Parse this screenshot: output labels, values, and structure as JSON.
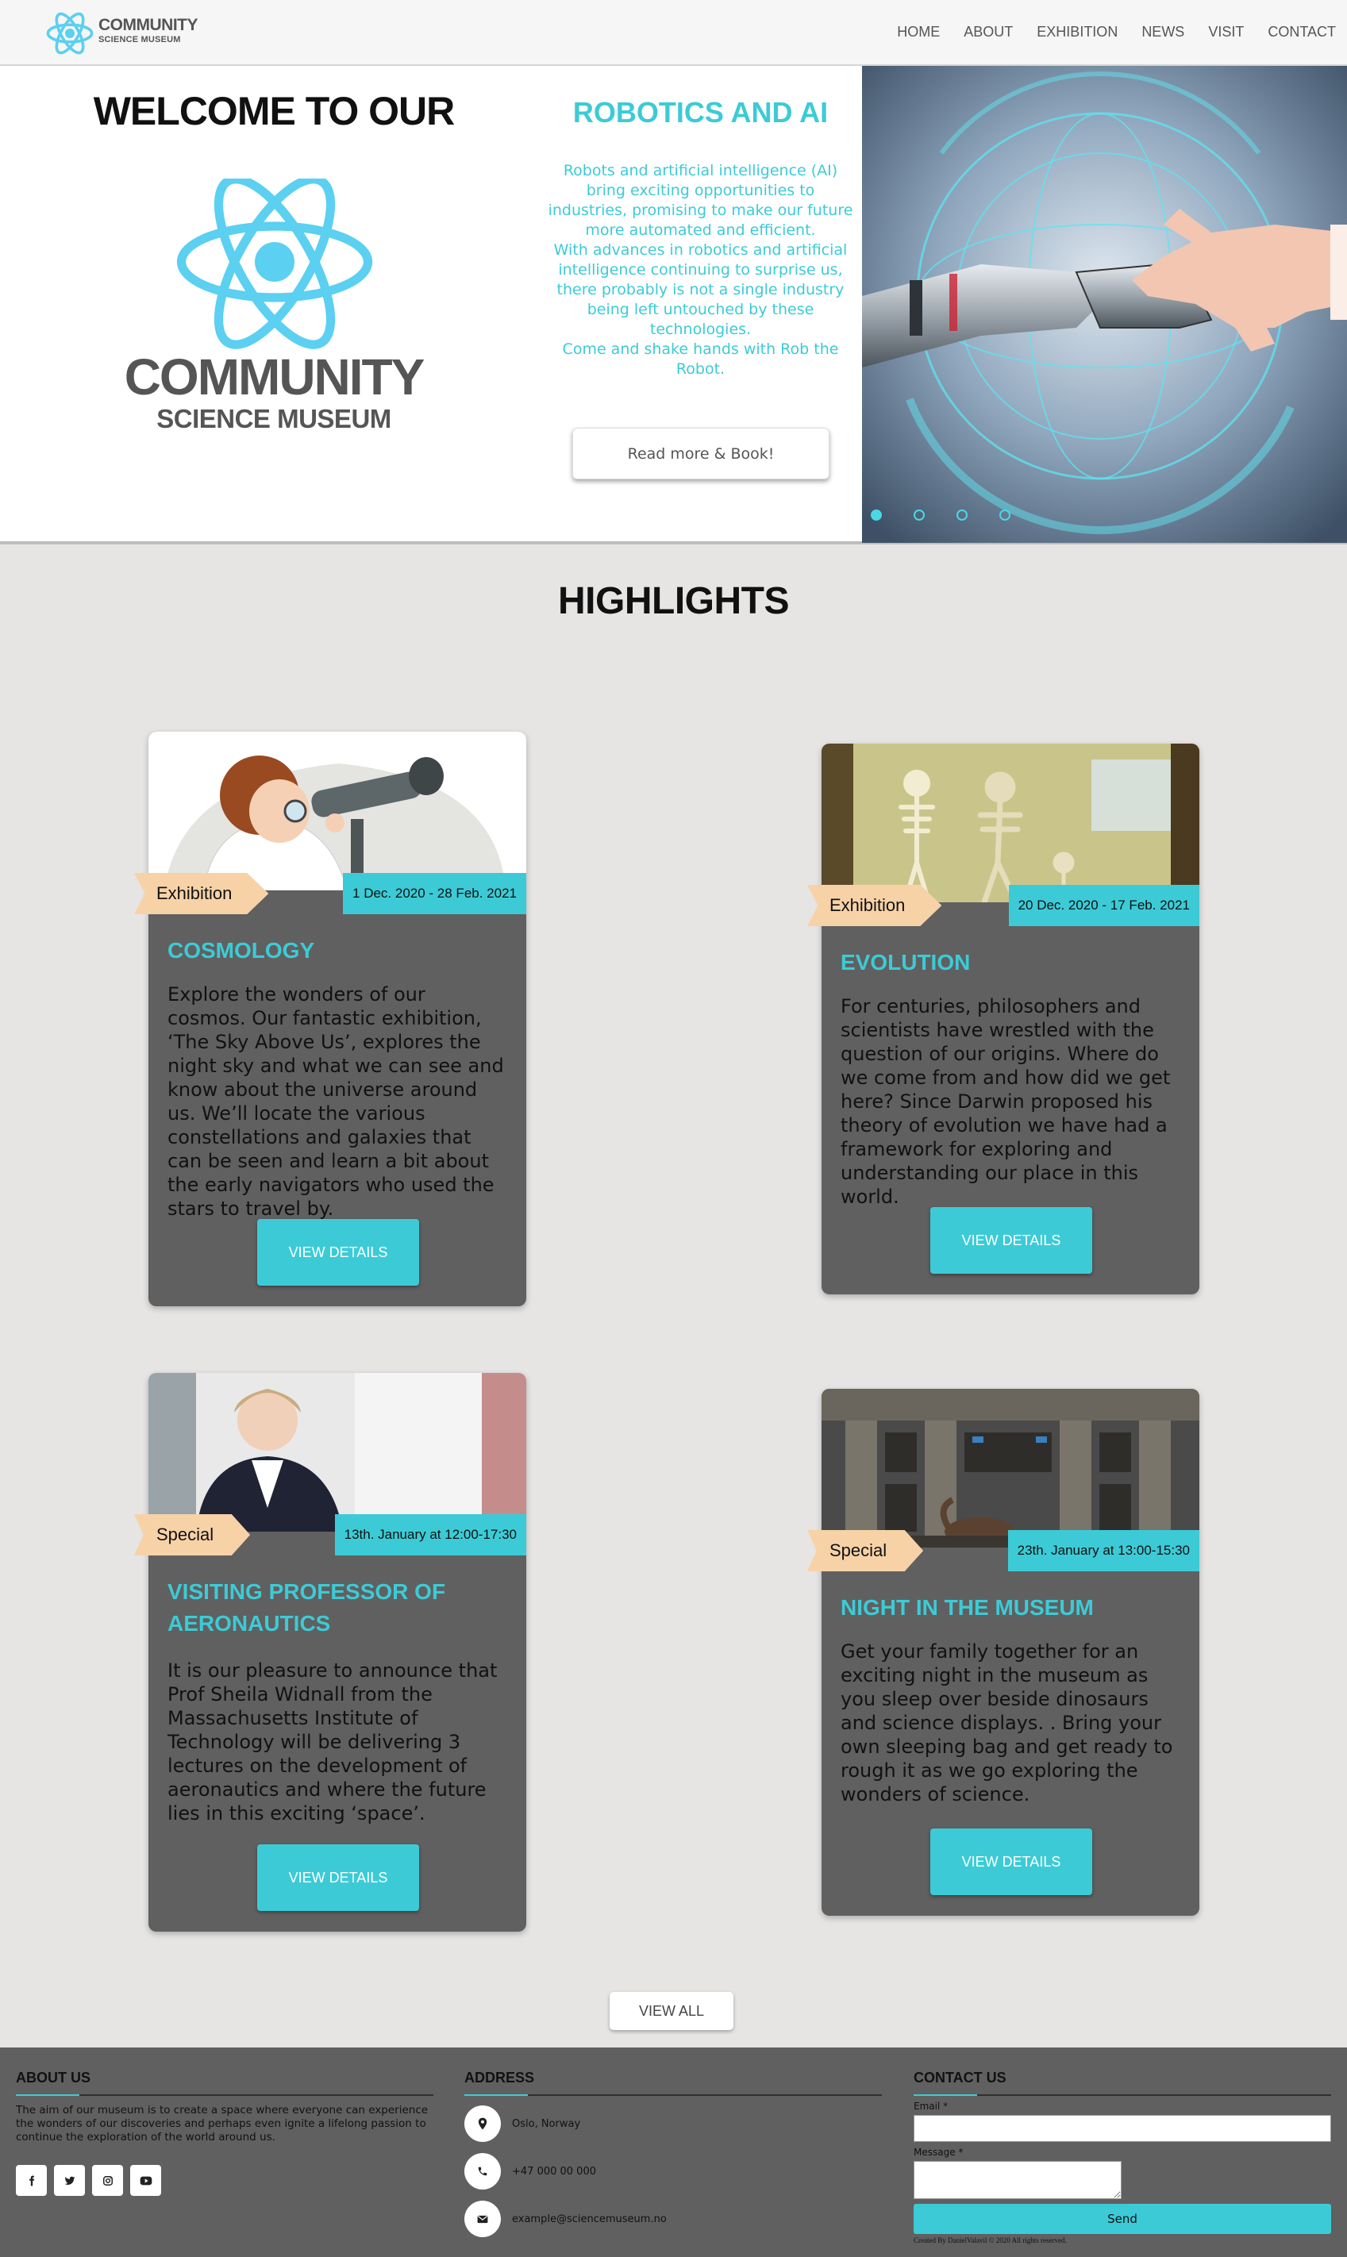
{
  "colors": {
    "accent": "#3ccbd6",
    "card": "#606060",
    "tag": "#f7d2a7",
    "background": "#e6e5e4"
  },
  "brand": {
    "line1": "COMMUNITY",
    "line2": "SCIENCE MUSEUM"
  },
  "nav": {
    "items": [
      "HOME",
      "ABOUT",
      "EXHIBITION",
      "NEWS",
      "VISIT",
      "CONTACT"
    ]
  },
  "hero": {
    "title": "WELCOME TO OUR",
    "slide_title": "ROBOTICS AND AI",
    "slide_text": "Robots and artificial intelligence (AI) bring exciting opportunities to industries, promising to make our future more automated and efficient.\nWith advances in robotics and artificial intelligence continuing to surprise us, there probably is not a single industry being left untouched by these technologies.\nCome and shake hands with Rob the Robot.",
    "button": "Read more & Book!",
    "slides_count": 4,
    "active_slide": 1
  },
  "highlights": {
    "title": "HIGHLIGHTS",
    "cards": [
      {
        "tag": "Exhibition",
        "date": "1 Dec. 2020 - 28 Feb. 2021",
        "title": "COSMOLOGY",
        "body": "Explore the wonders of our cosmos. Our fantastic exhibition, ‘The Sky Above Us’, explores the night sky and what we can see and know about the universe around us. We’ll locate the various constellations and galaxies that can be seen and learn a bit about the early navigators who used the stars to travel by.",
        "button": "VIEW DETAILS"
      },
      {
        "tag": "Exhibition",
        "date": "20 Dec. 2020 - 17 Feb. 2021",
        "title": "EVOLUTION",
        "body": "For centuries, philosophers and scientists have wrestled with the question of our origins. Where do we come from and how did we get here? Since Darwin proposed his theory of evolution we have had a framework for exploring and understanding our place in this world.",
        "button": "VIEW DETAILS"
      },
      {
        "tag": "Special",
        "date": "13th. January at 12:00-17:30",
        "title": "VISITING PROFESSOR OF AERONAUTICS",
        "body": "It is our pleasure to announce that Prof Sheila Widnall from the Massachusetts Institute of Technology will be delivering 3 lectures on the development of aeronautics and where the future lies in this exciting ‘space’.",
        "button": "VIEW DETAILS"
      },
      {
        "tag": "Special",
        "date": "23th. January at 13:00-15:30",
        "title": "NIGHT IN THE MUSEUM",
        "body": "Get your family together for an exciting night in the museum as you sleep over beside dinosaurs and science displays. . Bring your own sleeping bag and get ready to rough it as we go exploring the wonders of science.",
        "button": "VIEW DETAILS"
      }
    ],
    "view_all": "VIEW ALL"
  },
  "footer": {
    "about": {
      "heading": "ABOUT US",
      "text": "The aim of our museum is to create a space where everyone can experience the wonders of our discoveries and perhaps even ignite a lifelong passion to continue the exploration of the world around us.",
      "socials": [
        "facebook-icon",
        "twitter-icon",
        "instagram-icon",
        "youtube-icon"
      ]
    },
    "address": {
      "heading": "ADDRESS",
      "location": "Oslo, Norway",
      "phone": "+47 000 00 000",
      "email": "example@sciencemuseum.no"
    },
    "contact": {
      "heading": "CONTACT US",
      "email_label": "Email *",
      "message_label": "Message *",
      "send": "Send",
      "credit": "Created By DanielValavil © 2020 All rights reserved."
    }
  }
}
